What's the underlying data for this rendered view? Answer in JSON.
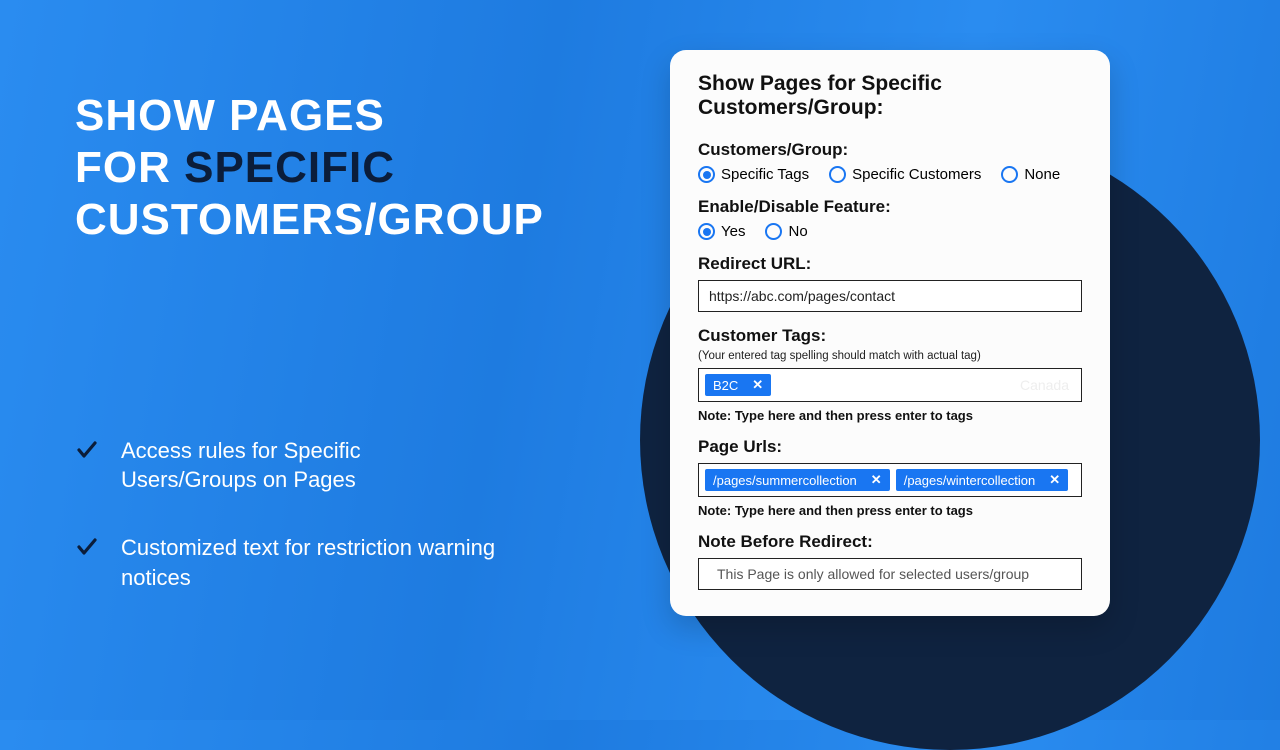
{
  "headline": {
    "line1": "SHOW PAGES",
    "line2_pre": "FOR ",
    "line2_accent": "SPECIFIC",
    "line3": "CUSTOMERS/GROUP"
  },
  "bullets": [
    "Access rules for Specific Users/Groups on Pages",
    "Customized text for restriction warning notices"
  ],
  "card": {
    "title": "Show Pages for Specific Customers/Group:",
    "customers_group": {
      "label": "Customers/Group:",
      "options": [
        "Specific Tags",
        "Specific Customers",
        "None"
      ],
      "selected": "Specific Tags"
    },
    "enable": {
      "label": "Enable/Disable Feature:",
      "options": [
        "Yes",
        "No"
      ],
      "selected": "Yes"
    },
    "redirect": {
      "label": "Redirect URL:",
      "value": "https://abc.com/pages/contact"
    },
    "customer_tags": {
      "label": "Customer Tags:",
      "hint": "(Your entered tag spelling should match with actual tag)",
      "tags": [
        "B2C"
      ],
      "placeholder_ghost": "Canada",
      "note": "Note: Type here and then press enter to tags"
    },
    "page_urls": {
      "label": "Page Urls:",
      "tags": [
        "/pages/summercollection",
        "/pages/wintercollection"
      ],
      "note": "Note: Type here and then press enter to tags"
    },
    "note_before": {
      "label": "Note Before Redirect:",
      "value": "This Page is only allowed for selected users/group"
    }
  }
}
